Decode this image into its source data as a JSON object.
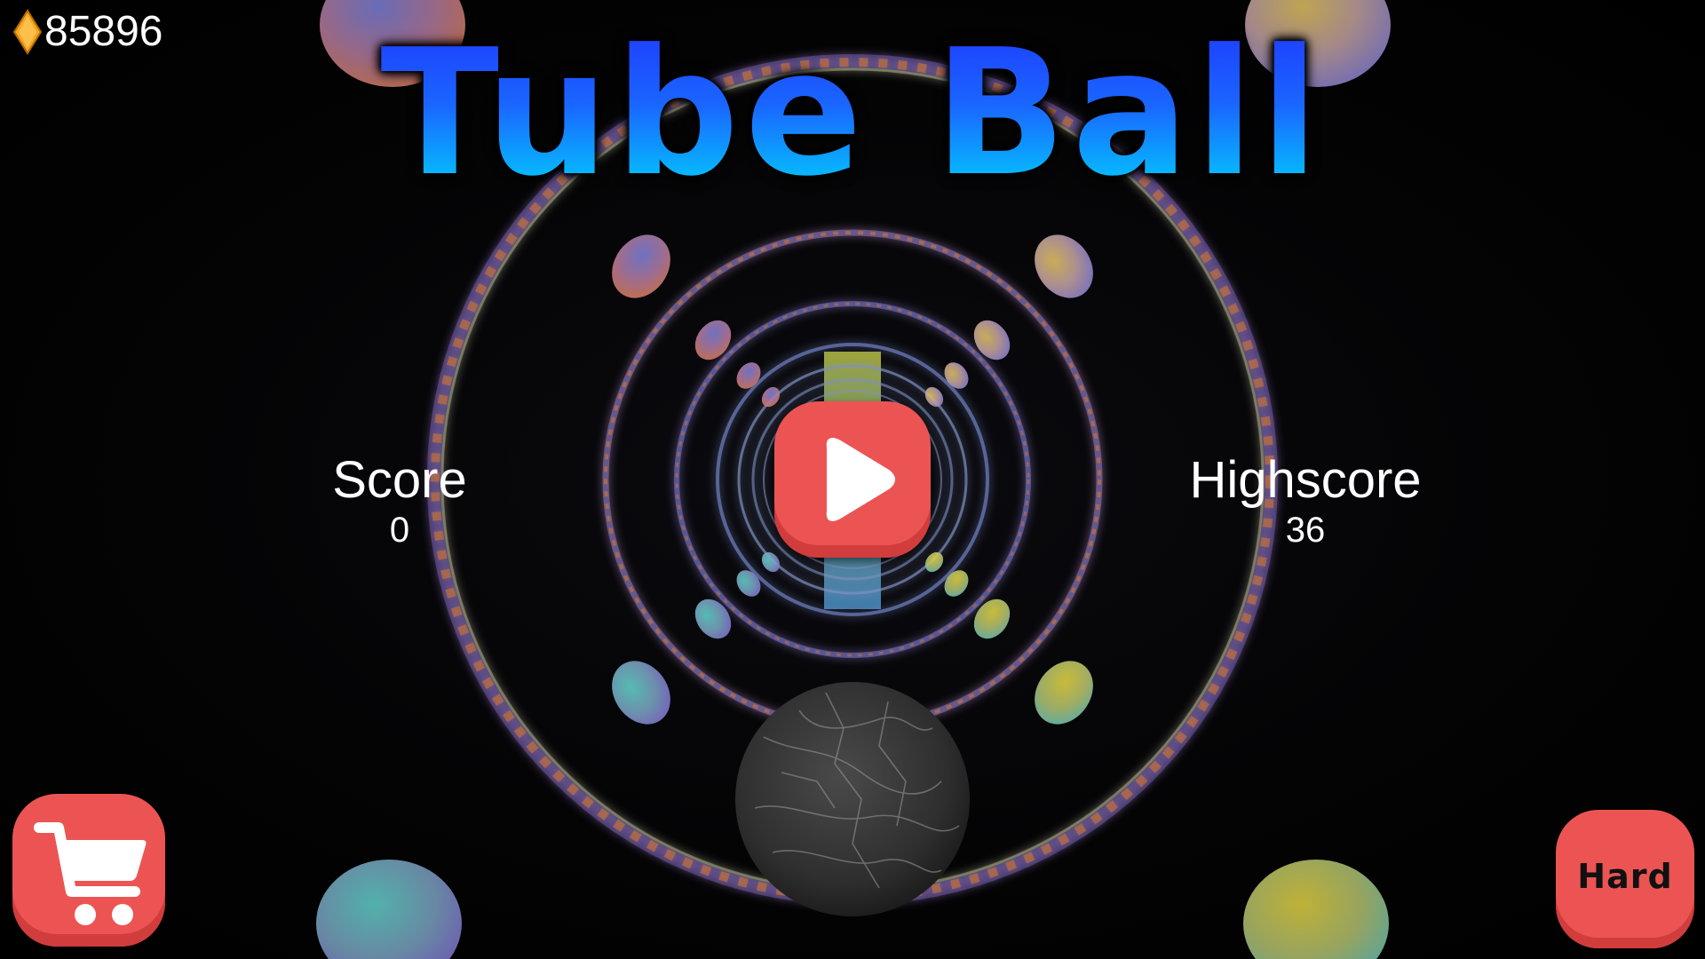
{
  "hud": {
    "coin_icon": "gem-diamond-icon",
    "coins": "85896"
  },
  "title": "Tube Ball",
  "score": {
    "label": "Score",
    "value": "0"
  },
  "highscore": {
    "label": "Highscore",
    "value": "36"
  },
  "buttons": {
    "play_icon": "play-icon",
    "shop_icon": "shopping-cart-icon",
    "mode_label": "Hard"
  },
  "colors": {
    "button_red": "#ec5454",
    "title_top": "#1f3cff",
    "title_bottom": "#00d6ff",
    "coin": "#f5a623"
  }
}
